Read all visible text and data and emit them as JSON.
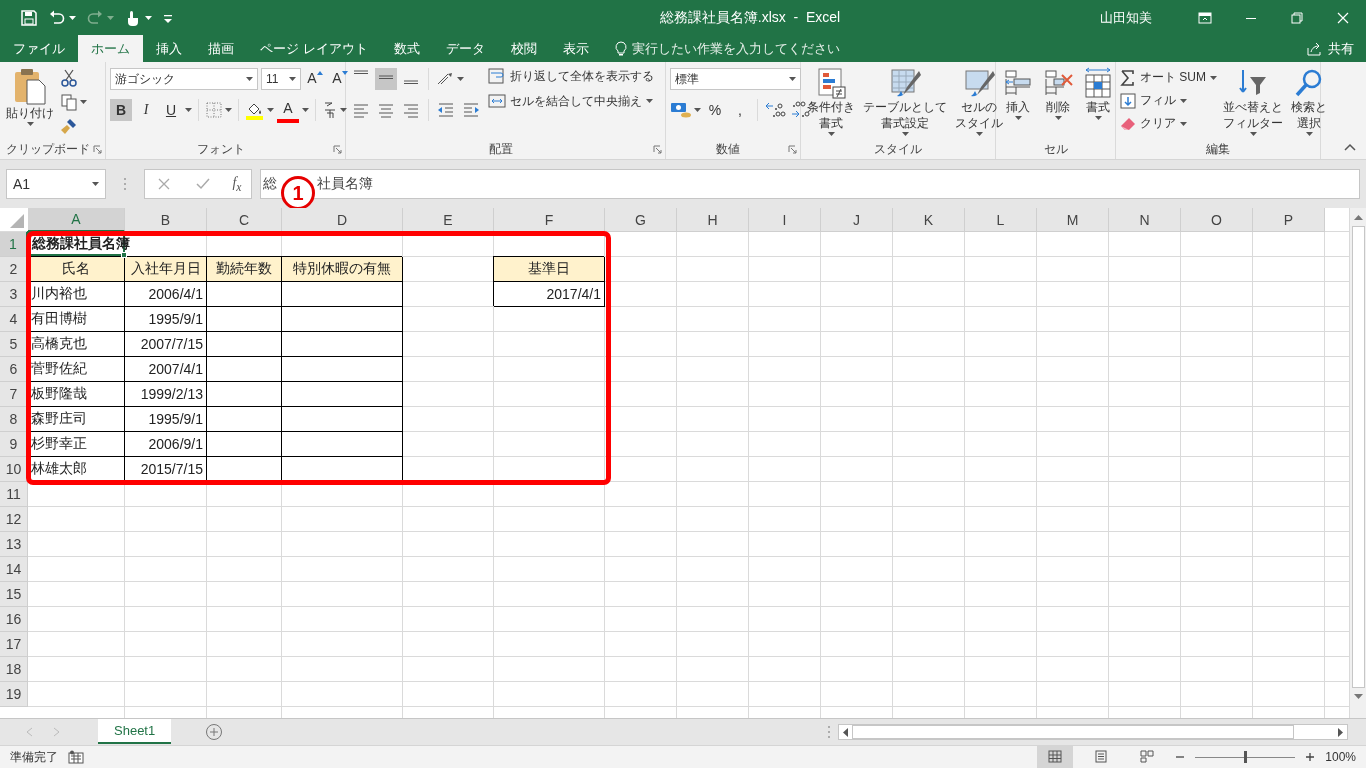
{
  "window": {
    "title": "総務課社員名簿.xlsx  -  Excel",
    "user": "山田知美"
  },
  "quick_access": [
    {
      "kind": "save",
      "disabled": false
    },
    {
      "kind": "undo",
      "disabled": false
    },
    {
      "kind": "redo",
      "disabled": true
    },
    {
      "kind": "touch",
      "disabled": false
    },
    {
      "kind": "customize",
      "disabled": false
    }
  ],
  "tabs": [
    {
      "label": "ファイル",
      "selected": false
    },
    {
      "label": "ホーム",
      "selected": true
    },
    {
      "label": "挿入",
      "selected": false
    },
    {
      "label": "描画",
      "selected": false
    },
    {
      "label": "ページ レイアウト",
      "selected": false
    },
    {
      "label": "数式",
      "selected": false
    },
    {
      "label": "データ",
      "selected": false
    },
    {
      "label": "校閲",
      "selected": false
    },
    {
      "label": "表示",
      "selected": false
    }
  ],
  "tell_me": {
    "placeholder": "実行したい作業を入力してください"
  },
  "share": "共有",
  "ribbon": {
    "clipboard": {
      "label": "クリップボード",
      "paste": "貼り付け"
    },
    "font": {
      "label": "フォント",
      "font_name": "游ゴシック",
      "pt": "11",
      "grow": "A",
      "shrink": "A",
      "bold": {
        "label": "B",
        "selected": true
      },
      "italic": {
        "label": "I",
        "selected": false
      },
      "underline": {
        "label": "U",
        "selected": false
      },
      "font_color": "A"
    },
    "alignment": {
      "label": "配置",
      "vertical": [
        {
          "selected": false
        },
        {
          "selected": true
        },
        {
          "selected": false
        }
      ],
      "wrap": "折り返して全体を表示する",
      "merge": "セルを結合して中央揃え"
    },
    "number": {
      "label": "数値",
      "format": "標準",
      "percent": "%",
      "comma": ","
    },
    "styles": {
      "label": "スタイル",
      "buttons": [
        {
          "kind": "conditional",
          "lines": [
            "条件付き",
            "書式"
          ]
        },
        {
          "kind": "table",
          "lines": [
            "テーブルとして",
            "書式設定"
          ]
        },
        {
          "kind": "cellstyle",
          "lines": [
            "セルの",
            "スタイル"
          ]
        }
      ]
    },
    "cells": {
      "label": "セル",
      "buttons": [
        {
          "kind": "insert",
          "lines": [
            "挿入"
          ]
        },
        {
          "kind": "delete",
          "lines": [
            "削除"
          ]
        },
        {
          "kind": "format",
          "lines": [
            "書式"
          ]
        }
      ]
    },
    "editing": {
      "label": "編集",
      "autosum": "オート SUM",
      "fill": "フィル",
      "clear": "クリア",
      "sort": [
        "並べ替えと",
        "フィルター"
      ],
      "find": [
        "検索と",
        "選択"
      ]
    }
  },
  "formula_bar": {
    "name_box": "A1",
    "function_button": "f$_{x}$",
    "value_parts": [
      "総",
      "社員名簿"
    ]
  },
  "annotation": {
    "label": "1"
  },
  "sheet": {
    "columns": [
      {
        "label": "A",
        "selected": true
      },
      {
        "label": "B",
        "selected": false
      },
      {
        "label": "C",
        "selected": false
      },
      {
        "label": "D",
        "selected": false
      },
      {
        "label": "E",
        "selected": false
      },
      {
        "label": "F",
        "selected": false
      },
      {
        "label": "G",
        "selected": false
      },
      {
        "label": "H",
        "selected": false
      },
      {
        "label": "I",
        "selected": false
      },
      {
        "label": "J",
        "selected": false
      },
      {
        "label": "K",
        "selected": false
      },
      {
        "label": "L",
        "selected": false
      },
      {
        "label": "M",
        "selected": false
      },
      {
        "label": "N",
        "selected": false
      },
      {
        "label": "O",
        "selected": false
      },
      {
        "label": "P",
        "selected": false
      }
    ],
    "rows": [
      {
        "label": "1",
        "selected": true,
        "cells": [
          {
            "kind": "title",
            "text": "総務課社員名簿",
            "selected": true
          }
        ]
      },
      {
        "label": "2",
        "selected": false,
        "cells": [
          {
            "kind": "header",
            "text": "氏名",
            "selected": false
          },
          {
            "kind": "header",
            "text": "入社年月日",
            "selected": false
          },
          {
            "kind": "header",
            "text": "勤続年数",
            "selected": false
          },
          {
            "kind": "header",
            "text": "特別休暇の有無",
            "selected": false
          },
          {
            "kind": "blank",
            "selected": false
          },
          {
            "kind": "header",
            "text": "基準日",
            "selected": false
          }
        ]
      },
      {
        "label": "3",
        "selected": false,
        "cells": [
          {
            "kind": "name",
            "text": "川内裕也",
            "selected": false
          },
          {
            "kind": "date",
            "text": "2006/4/1",
            "selected": false
          },
          {
            "kind": "empty",
            "selected": false
          },
          {
            "kind": "empty",
            "selected": false
          },
          {
            "kind": "blank",
            "selected": false
          },
          {
            "kind": "date",
            "text": "2017/4/1",
            "selected": false
          }
        ]
      },
      {
        "label": "4",
        "selected": false,
        "cells": [
          {
            "kind": "name",
            "text": "有田博樹",
            "selected": false
          },
          {
            "kind": "date",
            "text": "1995/9/1",
            "selected": false
          },
          {
            "kind": "empty",
            "selected": false
          },
          {
            "kind": "empty",
            "selected": false
          }
        ]
      },
      {
        "label": "5",
        "selected": false,
        "cells": [
          {
            "kind": "name",
            "text": "高橋克也",
            "selected": false
          },
          {
            "kind": "date",
            "text": "2007/7/15",
            "selected": false
          },
          {
            "kind": "empty",
            "selected": false
          },
          {
            "kind": "empty",
            "selected": false
          }
        ]
      },
      {
        "label": "6",
        "selected": false,
        "cells": [
          {
            "kind": "name",
            "text": "菅野佐紀",
            "selected": false
          },
          {
            "kind": "date",
            "text": "2007/4/1",
            "selected": false
          },
          {
            "kind": "empty",
            "selected": false
          },
          {
            "kind": "empty",
            "selected": false
          }
        ]
      },
      {
        "label": "7",
        "selected": false,
        "cells": [
          {
            "kind": "name",
            "text": "板野隆哉",
            "selected": false
          },
          {
            "kind": "date",
            "text": "1999/2/13",
            "selected": false
          },
          {
            "kind": "empty",
            "selected": false
          },
          {
            "kind": "empty",
            "selected": false
          }
        ]
      },
      {
        "label": "8",
        "selected": false,
        "cells": [
          {
            "kind": "name",
            "text": "森野庄司",
            "selected": false
          },
          {
            "kind": "date",
            "text": "1995/9/1",
            "selected": false
          },
          {
            "kind": "empty",
            "selected": false
          },
          {
            "kind": "empty",
            "selected": false
          }
        ]
      },
      {
        "label": "9",
        "selected": false,
        "cells": [
          {
            "kind": "name",
            "text": "杉野幸正",
            "selected": false
          },
          {
            "kind": "date",
            "text": "2006/9/1",
            "selected": false
          },
          {
            "kind": "empty",
            "selected": false
          },
          {
            "kind": "empty",
            "selected": false
          }
        ]
      },
      {
        "label": "10",
        "selected": false,
        "cells": [
          {
            "kind": "name",
            "text": "林雄太郎",
            "selected": false
          },
          {
            "kind": "date",
            "text": "2015/7/15",
            "selected": false
          },
          {
            "kind": "empty",
            "selected": false
          },
          {
            "kind": "empty",
            "selected": false
          }
        ]
      },
      {
        "label": "11",
        "selected": false
      },
      {
        "label": "12",
        "selected": false
      },
      {
        "label": "13",
        "selected": false
      },
      {
        "label": "14",
        "selected": false
      },
      {
        "label": "15",
        "selected": false
      },
      {
        "label": "16",
        "selected": false
      },
      {
        "label": "17",
        "selected": false
      },
      {
        "label": "18",
        "selected": false
      },
      {
        "label": "19",
        "selected": false
      }
    ]
  },
  "sheet_tabs": [
    {
      "label": "Sheet1",
      "selected": true
    }
  ],
  "status_bar": {
    "text": "準備完了",
    "views": [
      {
        "selected": true
      },
      {
        "selected": false
      },
      {
        "selected": false
      }
    ],
    "zoom": {
      "level": 0.5
    },
    "zoom_label": "100%"
  }
}
